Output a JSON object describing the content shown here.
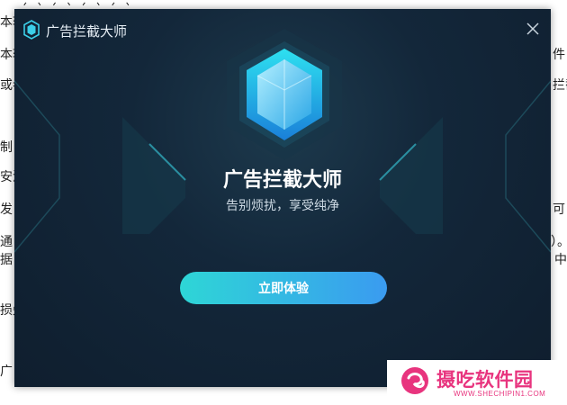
{
  "background_doc": {
    "left_fragments": [
      "本软",
      "本软",
      "或者",
      "制",
      "安汇",
      "发",
      "通",
      "据",
      "损失",
      "广"
    ],
    "right_fragments": [
      "件",
      "拦截",
      "可",
      "）。",
      "中"
    ],
    "top_fragment": "（...）（...）（...）（...）"
  },
  "dialog": {
    "title": "广告拦截大师",
    "heading": "广告拦截大师",
    "tagline": "告别烦扰，享受纯净",
    "cta_label": "立即体验",
    "close_icon": "close-icon",
    "app_icon": "shield-icon",
    "accent_color": "#2ed6d6",
    "accent_color_end": "#3a9bf0",
    "background_color": "#13273a"
  },
  "watermark": {
    "text": "摄吃软件园",
    "url": "WWW.SHECHIPIN1.COM",
    "color": "#e8347e"
  }
}
